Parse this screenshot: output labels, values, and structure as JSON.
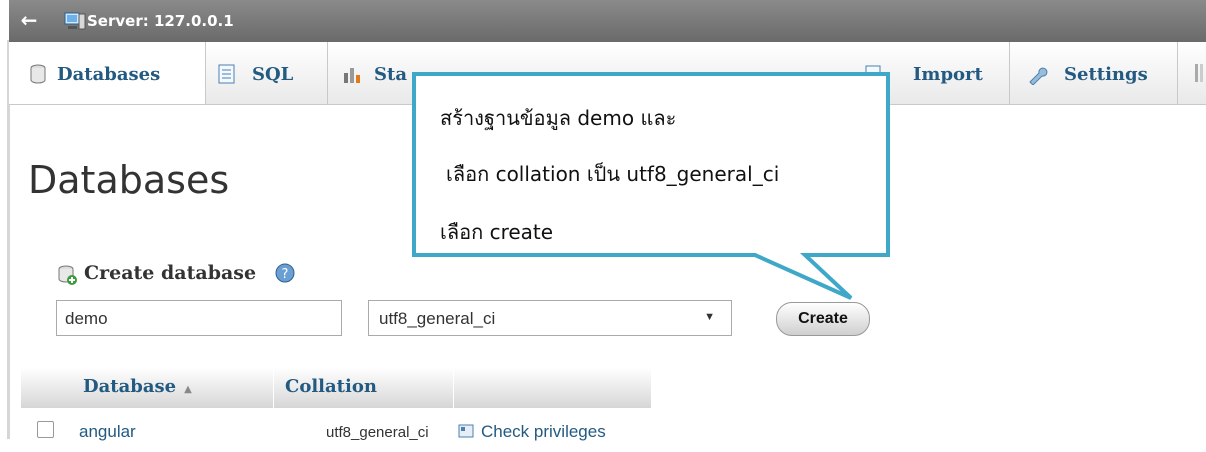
{
  "topbar": {
    "back": "←",
    "server_label": "Server: 127.0.0.1"
  },
  "tabs": [
    {
      "label": "Databases",
      "icon": "database-icon"
    },
    {
      "label": "SQL",
      "icon": "sql-icon"
    },
    {
      "label": "Sta",
      "icon": "status-icon"
    },
    {
      "label": "Import",
      "icon": "import-icon"
    },
    {
      "label": "Settings",
      "icon": "settings-icon"
    }
  ],
  "main": {
    "title": "Databases",
    "create_title": "Create database",
    "db_name_value": "demo",
    "collation_value": "utf8_general_ci",
    "create_button": "Create"
  },
  "table": {
    "headers": {
      "database": "Database",
      "collation": "Collation"
    },
    "rows": [
      {
        "name": "angular",
        "collation": "utf8_general_ci",
        "action": "Check privileges"
      }
    ]
  },
  "callout": {
    "line1": "สร้างฐานข้อมูล demo และ",
    "line2": "เลือก collation เป็น utf8_general_ci",
    "line3": "เลือก create"
  },
  "colors": {
    "accent": "#235a81",
    "callout_border": "#3fa7c7"
  }
}
